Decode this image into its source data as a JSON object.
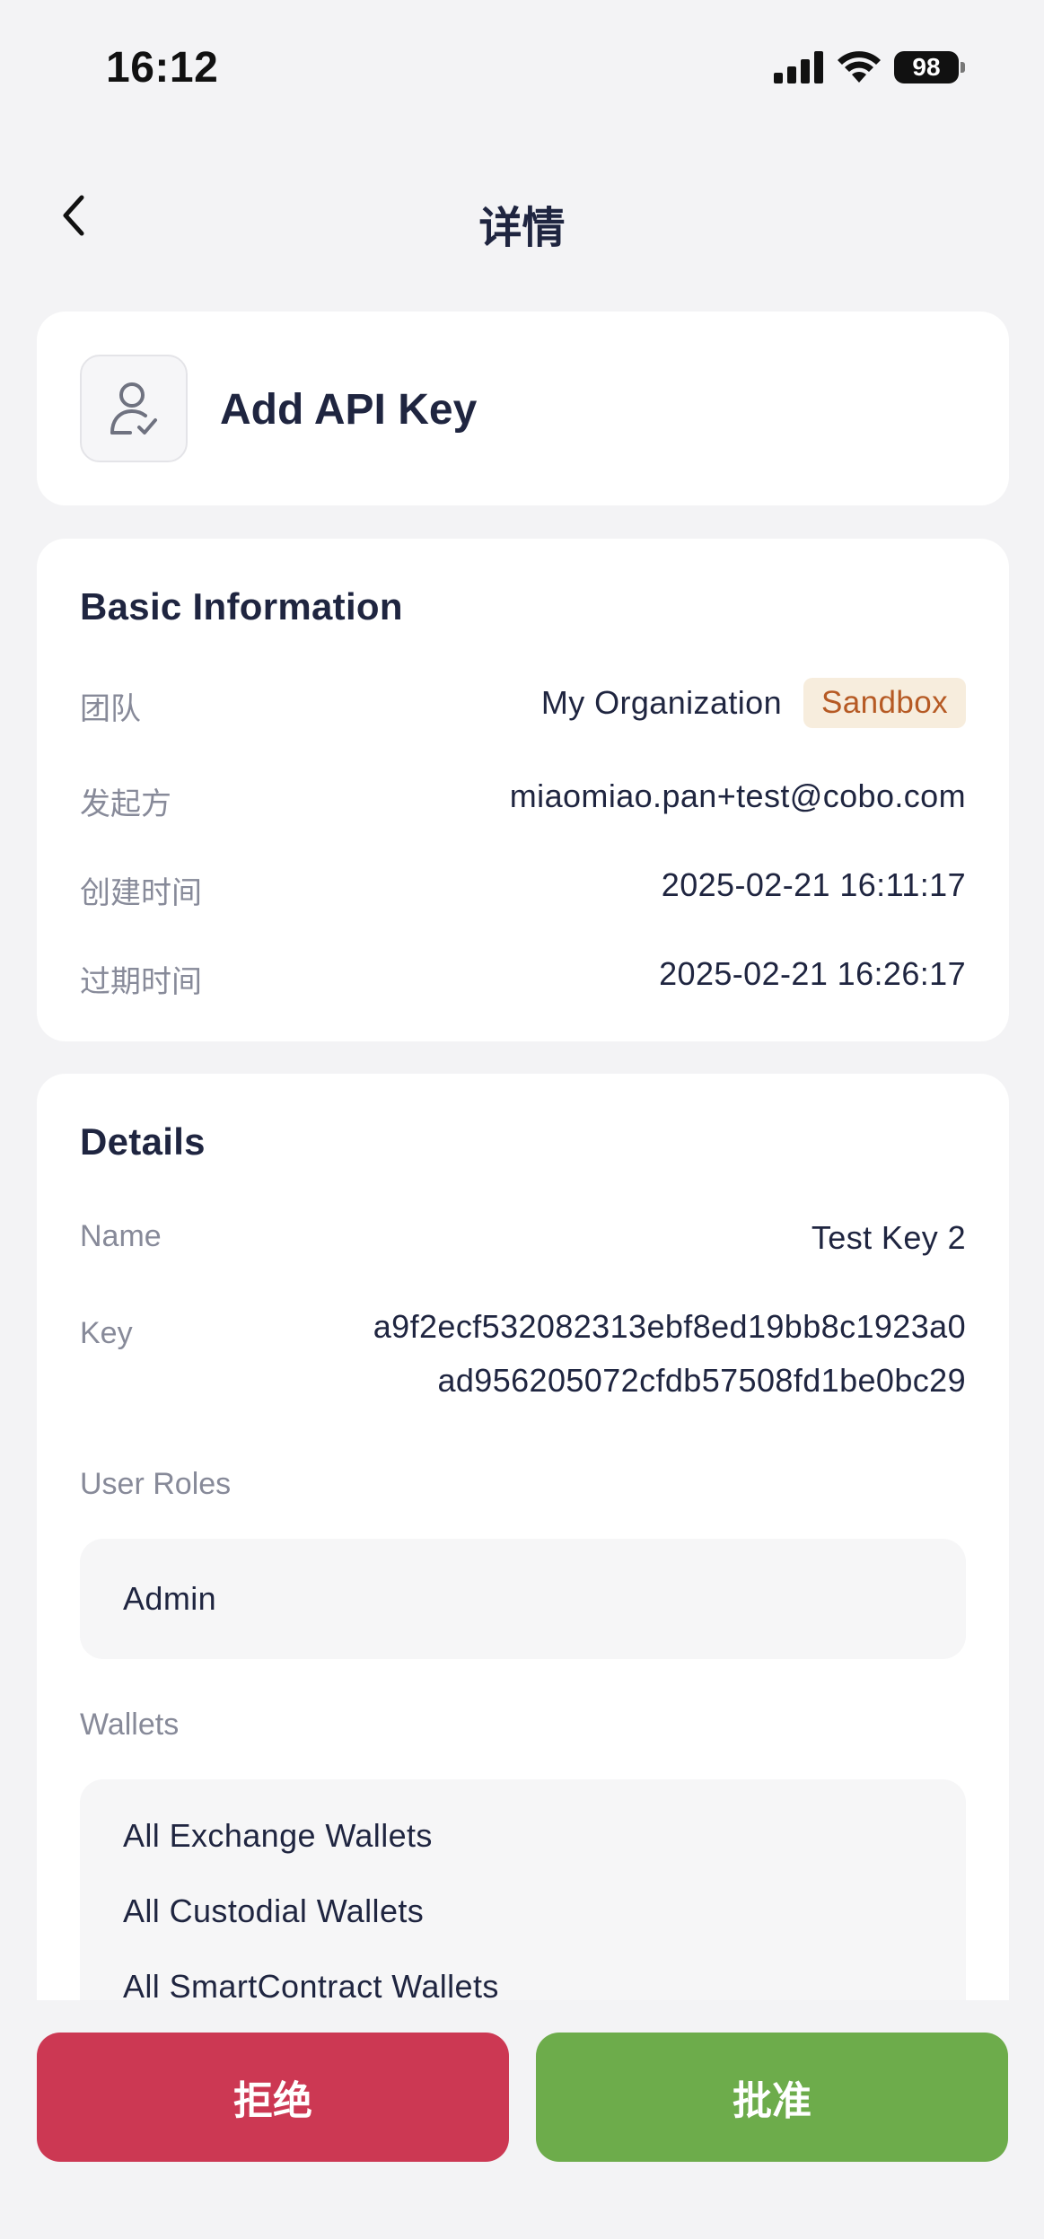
{
  "status_bar": {
    "time": "16:12",
    "battery": "98"
  },
  "nav": {
    "title": "详情"
  },
  "header": {
    "title": "Add API Key",
    "icon": "user-check-icon"
  },
  "basic_info": {
    "title": "Basic Information",
    "rows": [
      {
        "label": "团队",
        "value": "My Organization",
        "badge": "Sandbox"
      },
      {
        "label": "发起方",
        "value": "miaomiao.pan+test@cobo.com"
      },
      {
        "label": "创建时间",
        "value": "2025-02-21 16:11:17"
      },
      {
        "label": "过期时间",
        "value": "2025-02-21 16:26:17"
      }
    ]
  },
  "details": {
    "title": "Details",
    "name_label": "Name",
    "name_value": "Test Key 2",
    "key_label": "Key",
    "key_line1": "a9f2ecf532082313ebf8ed19bb8c1923a0",
    "key_line2": "ad956205072cfdb57508fd1be0bc29",
    "roles_label": "User Roles",
    "roles": [
      "Admin"
    ],
    "wallets_label": "Wallets",
    "wallets": [
      "All Exchange Wallets",
      "All Custodial Wallets",
      "All SmartContract Wallets"
    ]
  },
  "actions": {
    "reject": "拒绝",
    "approve": "批准"
  },
  "colors": {
    "reject": "#cc3853",
    "approve": "#6dac4b",
    "badge_bg": "#f7eddd",
    "badge_text": "#b65a24"
  }
}
